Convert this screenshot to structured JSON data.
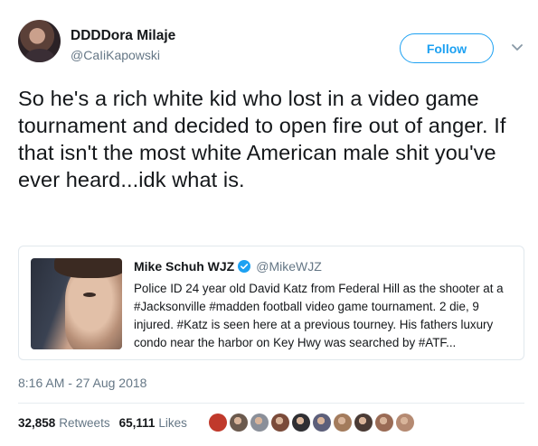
{
  "author": {
    "name": "DDDDora Milaje",
    "handle": "@CaIiKapowski",
    "follow_label": "Follow"
  },
  "tweet": {
    "text": "So he's a rich white kid who lost in a video game tournament and decided to open fire out of anger. If that isn't the most white American male shit you've ever heard...idk what is."
  },
  "quoted_tweet": {
    "author_name": "Mike Schuh WJZ",
    "author_handle": "@MikeWJZ",
    "verified": true,
    "text": "Police ID 24 year old David Katz from Federal Hill as the shooter at a #Jacksonville #madden football video game tournament. 2 die, 9 injured. #Katz is seen here at a previous tourney. His fathers luxury condo near the harbor on Key Hwy was searched by #ATF..."
  },
  "meta": {
    "timestamp": "8:16 AM - 27 Aug 2018"
  },
  "stats": {
    "retweets_count": "32,858",
    "retweets_label": "Retweets",
    "likes_count": "65,111",
    "likes_label": "Likes"
  },
  "likers": [
    {
      "color": "#c0392b"
    },
    {
      "color": "#6b5a4e"
    },
    {
      "color": "#8a8f99"
    },
    {
      "color": "#7a4b3a"
    },
    {
      "color": "#2f2f33"
    },
    {
      "color": "#5c5f7a"
    },
    {
      "color": "#a37b5c"
    },
    {
      "color": "#4a3b35"
    },
    {
      "color": "#9a6b55"
    },
    {
      "color": "#b58a72"
    }
  ],
  "colors": {
    "accent": "#1da1f2",
    "secondary_text": "#657786",
    "border": "#e1e8ed"
  }
}
